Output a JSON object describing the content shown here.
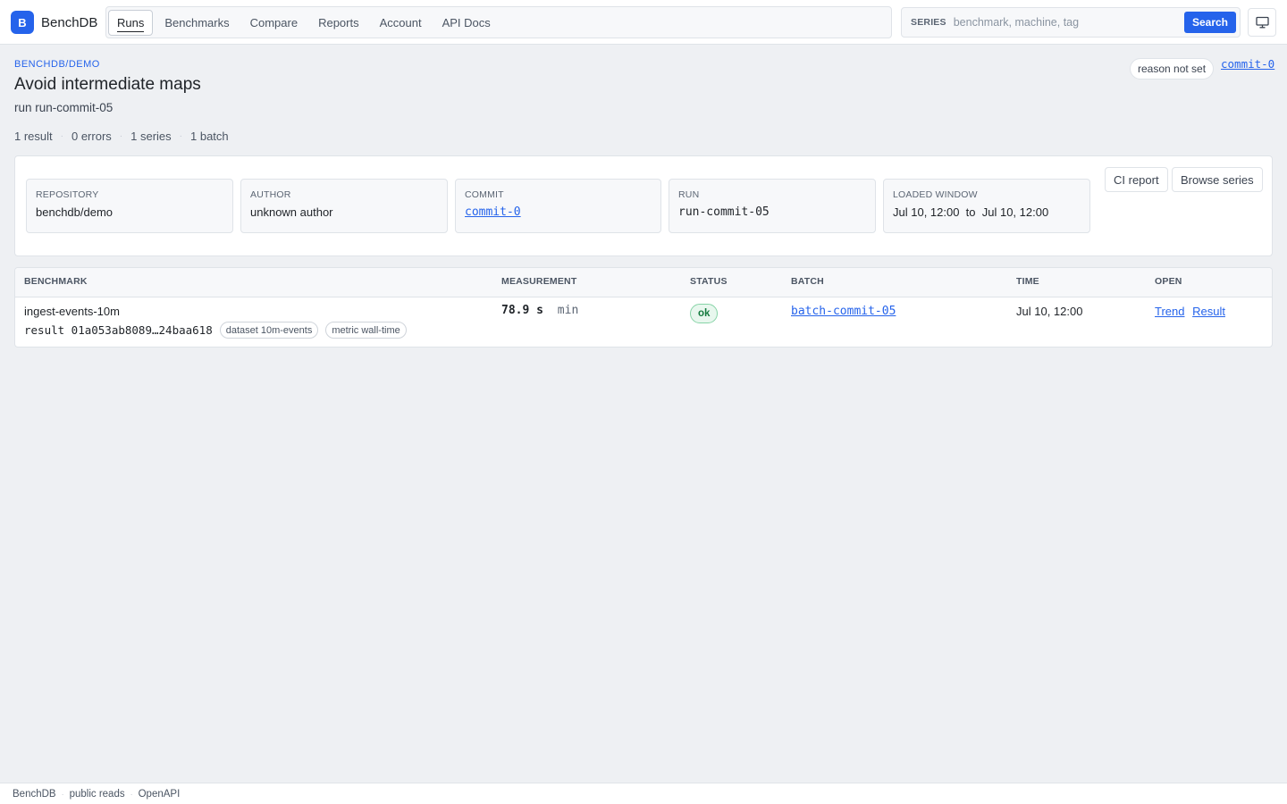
{
  "brand": {
    "logo_letter": "B",
    "name": "BenchDB"
  },
  "nav": {
    "items": [
      {
        "label": "Runs",
        "active": true
      },
      {
        "label": "Benchmarks"
      },
      {
        "label": "Compare"
      },
      {
        "label": "Reports"
      },
      {
        "label": "Account"
      },
      {
        "label": "API Docs"
      }
    ]
  },
  "search": {
    "label": "SERIES",
    "placeholder": "benchmark, machine, tag",
    "button": "Search"
  },
  "header": {
    "eyebrow": "BENCHDB/DEMO",
    "title": "Avoid intermediate maps",
    "subtitle": "run run-commit-05",
    "stats": [
      "1 result",
      "0 errors",
      "1 series",
      "1 batch"
    ],
    "reason_pill": "reason not set",
    "commit_link": "commit-0"
  },
  "info": {
    "repository": {
      "label": "REPOSITORY",
      "value": "benchdb/demo"
    },
    "author": {
      "label": "AUTHOR",
      "value": "unknown author"
    },
    "commit": {
      "label": "COMMIT",
      "value": "commit-0"
    },
    "run": {
      "label": "RUN",
      "value": "run-commit-05"
    },
    "window": {
      "label": "LOADED WINDOW",
      "value": "Jul 10, 12:00  to  Jul 10, 12:00"
    },
    "buttons": {
      "ci_report": "CI report",
      "browse_series": "Browse series"
    }
  },
  "table": {
    "columns": [
      "BENCHMARK",
      "MEASUREMENT",
      "STATUS",
      "BATCH",
      "TIME",
      "OPEN"
    ],
    "rows": [
      {
        "benchmark": "ingest-events-10m",
        "result_id": "result 01a053ab8089…24baa618",
        "tags": [
          "dataset 10m-events",
          "metric wall-time"
        ],
        "measurement_value": "78.9 s",
        "measurement_stat": "min",
        "status": "ok",
        "batch": "batch-commit-05",
        "time": "Jul 10, 12:00",
        "open_links": [
          "Trend",
          "Result"
        ]
      }
    ]
  },
  "footer": {
    "items": [
      "BenchDB",
      "public reads",
      "OpenAPI"
    ]
  },
  "colors": {
    "accent": "#2563eb",
    "ok": "#137a3e",
    "background": "#eef0f3"
  },
  "icons": {
    "display": "monitor-icon"
  }
}
